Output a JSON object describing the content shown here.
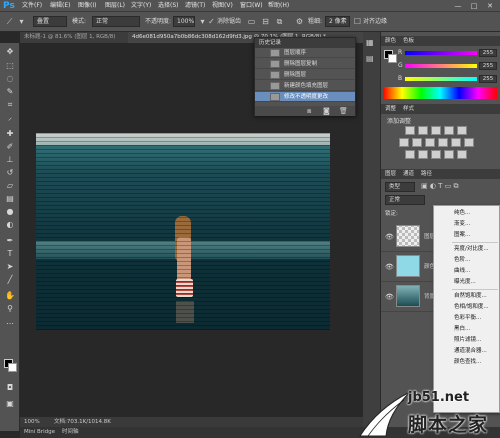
{
  "app": {
    "logo": "Ps"
  },
  "menu": [
    "文件(F)",
    "编辑(E)",
    "图像(I)",
    "图层(L)",
    "文字(Y)",
    "选择(S)",
    "滤镜(T)",
    "视图(V)",
    "窗口(W)",
    "帮助(H)"
  ],
  "window_controls": [
    "—",
    "□",
    "✕"
  ],
  "options": {
    "preset": "叠置",
    "mode_label": "模式:",
    "mode_value": "正常",
    "opacity_label": "不透明度:",
    "opacity_value": "100%",
    "smooth_label": "消除锯齿",
    "step_label": "粗细:",
    "step_value": "2 像素",
    "align_label": "对齐边缘"
  },
  "tabs": {
    "tab1": "未标题-1 @ 81.6% (图层 1, RGB/8)",
    "tab2": "4d6e081d950a7b0b86dc308d162d9fd3.jpg @ 70.1% (图层 1, RGB/8) *"
  },
  "history": {
    "title": "历史记录",
    "items": [
      "图层顺序",
      "删除图层复制",
      "删除图层",
      "新建颜色填充图层",
      "修改不透明度更改"
    ],
    "active_index": 4
  },
  "color_panel": {
    "tabs": [
      "颜色",
      "色板"
    ],
    "rows": [
      {
        "label": "R",
        "value": "255",
        "color": "#ff00ff"
      },
      {
        "label": "G",
        "value": "255",
        "color": "#ffff00"
      },
      {
        "label": "B",
        "value": "255",
        "color": "#00ffff"
      }
    ]
  },
  "adjust_panel": {
    "tabs": [
      "调整",
      "样式"
    ],
    "title": "添加调整"
  },
  "layers_panel": {
    "tabs": [
      "图层",
      "通道",
      "路径"
    ],
    "kind_label": "类型",
    "blend_mode": "正常",
    "lock_label": "锁定:",
    "layers": [
      "图层 1",
      "颜色填充 1",
      "背景"
    ]
  },
  "context_menu": {
    "items": [
      "纯色...",
      "渐变...",
      "图案...",
      "亮度/对比度...",
      "色阶...",
      "曲线...",
      "曝光度...",
      "自然饱和度...",
      "色相/饱和度...",
      "色彩平衡...",
      "黑白...",
      "照片滤镜...",
      "通道混合器...",
      "颜色查找..."
    ],
    "separators_after": [
      2,
      6
    ]
  },
  "status": {
    "zoom": "100%",
    "doc": "文档:703.1K/1014.8K"
  },
  "bottom_tabs": [
    "Mini Bridge",
    "时间轴"
  ],
  "watermark": {
    "url": "jb51.net",
    "brand": "脚本之家"
  }
}
